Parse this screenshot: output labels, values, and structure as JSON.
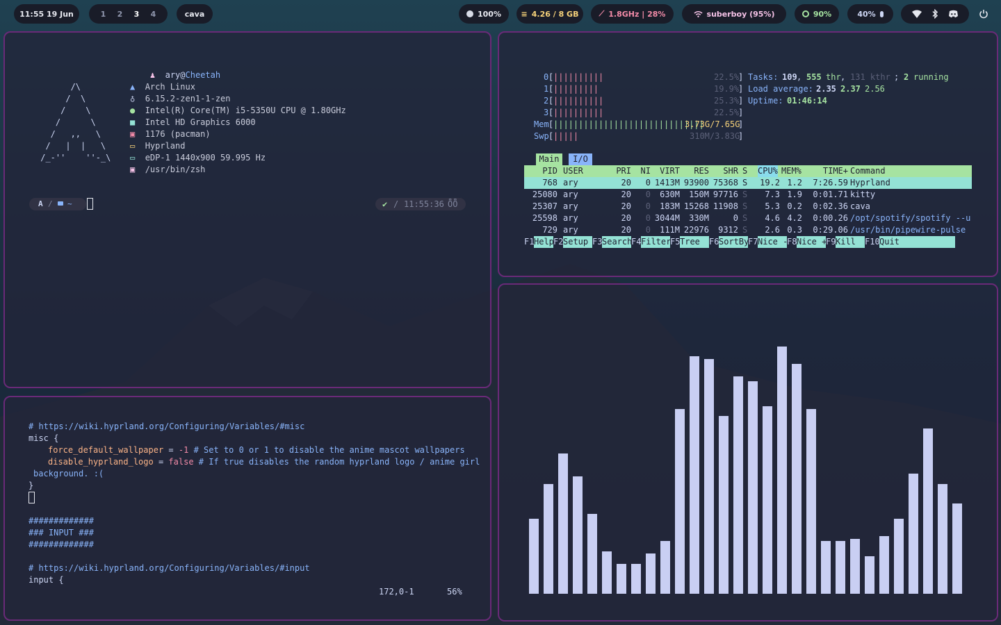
{
  "topbar": {
    "clock": "11:55  19 Jun",
    "workspaces": [
      "1",
      "2",
      "3",
      "4"
    ],
    "active_workspace": "3",
    "active_window": "cava",
    "battery": "100%",
    "memory": "4.26 / 8 GB",
    "cpu": "1.8GHz | 28%",
    "wifi": "suberboy (95%)",
    "brightness": "90%",
    "volume": "40%",
    "colors": {
      "memory": "#f6d27a",
      "cpu": "#f38ba8",
      "wifi": "#f5c2e7",
      "brightness": "#a6e3a1",
      "volume": "#cdd6f4"
    }
  },
  "fastfetch": {
    "user": "ary",
    "at": "@",
    "host": "Cheetah",
    "logo": [
      "       /\\",
      "      /  \\",
      "     /    \\",
      "    /      \\",
      "   /   ,,   \\",
      "  /   |  |   \\",
      " /_-''    ''-_\\"
    ],
    "os": "Arch Linux",
    "kernel": "6.15.2-zen1-1-zen",
    "cpu": "Intel(R) Core(TM) i5-5350U CPU @ 1.80GHz",
    "gpu": "Intel HD Graphics 6000",
    "packages": "1176 (pacman)",
    "wm": "Hyprland",
    "display": "eDP-1 1440x900 59.995 Hz",
    "shell": "/usr/bin/zsh",
    "prompt_tilde": "~",
    "prompt_time": "11:55:36"
  },
  "htop": {
    "cpus": [
      {
        "id": "0",
        "bars": "||||||||||",
        "pct": "22.5%"
      },
      {
        "id": "1",
        "bars": "|||||||||",
        "pct": "19.9%"
      },
      {
        "id": "2",
        "bars": "||||||||||",
        "pct": "25.3%"
      },
      {
        "id": "3",
        "bars": "||||||||||",
        "pct": "22.5%"
      }
    ],
    "mem_label": "Mem",
    "mem_bars": "||||||||||||||||||||||||||||||",
    "mem_value": "3.73G/7.65G",
    "swp_label": "Swp",
    "swp_bars": "|||||",
    "swp_value": "310M/3.83G",
    "tasks_label": "Tasks:",
    "tasks": "109",
    "thr": "555",
    "thr_label": "thr",
    "kthr": "131 kthr",
    "running": "2",
    "running_label": "running",
    "load_label": "Load average:",
    "load1": "2.35",
    "load5": "2.37",
    "load15": "2.56",
    "uptime_label": "Uptime:",
    "uptime": "01:46:14",
    "tabs": [
      "Main",
      "I/O"
    ],
    "columns": [
      "PID",
      "USER",
      "PRI",
      "NI",
      "VIRT",
      "RES",
      "SHR",
      "S",
      "CPU%",
      "MEM%",
      "TIME+",
      "Command"
    ],
    "rows": [
      {
        "pid": "768",
        "user": "ary",
        "pri": "20",
        "ni": "0",
        "virt": "1413M",
        "res": "93900",
        "shr": "75368",
        "s": "S",
        "cpu": "19.2",
        "mem": "1.2",
        "time": "7:26.59",
        "cmd": "Hyprland"
      },
      {
        "pid": "25080",
        "user": "ary",
        "pri": "20",
        "ni": "0",
        "virt": "630M",
        "res": "150M",
        "shr": "97716",
        "s": "S",
        "cpu": "7.3",
        "mem": "1.9",
        "time": "0:01.71",
        "cmd": "kitty"
      },
      {
        "pid": "25307",
        "user": "ary",
        "pri": "20",
        "ni": "0",
        "virt": "183M",
        "res": "15268",
        "shr": "11908",
        "s": "S",
        "cpu": "5.3",
        "mem": "0.2",
        "time": "0:02.36",
        "cmd": "cava"
      },
      {
        "pid": "25598",
        "user": "ary",
        "pri": "20",
        "ni": "0",
        "virt": "3044M",
        "res": "330M",
        "shr": "0",
        "s": "S",
        "cpu": "4.6",
        "mem": "4.2",
        "time": "0:00.26",
        "cmd": "/opt/spotify/spotify --ur"
      },
      {
        "pid": "729",
        "user": "ary",
        "pri": "20",
        "ni": "0",
        "virt": "111M",
        "res": "22976",
        "shr": "9312",
        "s": "S",
        "cpu": "2.6",
        "mem": "0.3",
        "time": "0:29.06",
        "cmd": "/usr/bin/pipewire-pulse"
      }
    ],
    "fkeys": [
      {
        "key": "F1",
        "label": "Help"
      },
      {
        "key": "F2",
        "label": "Setup"
      },
      {
        "key": "F3",
        "label": "Search"
      },
      {
        "key": "F4",
        "label": "Filter"
      },
      {
        "key": "F5",
        "label": "Tree"
      },
      {
        "key": "F6",
        "label": "SortBy"
      },
      {
        "key": "F7",
        "label": "Nice -"
      },
      {
        "key": "F8",
        "label": "Nice +"
      },
      {
        "key": "F9",
        "label": "Kill"
      },
      {
        "key": "F10",
        "label": "Quit"
      }
    ]
  },
  "editor": {
    "lines": [
      "# https://wiki.hyprland.org/Configuring/Variables/#misc",
      "misc {",
      "force_default_wallpaper",
      "=",
      "-1",
      "# Set to 0 or 1 to disable the anime mascot wallpapers",
      "disable_hyprland_logo",
      "false",
      "# If true disables the random hyprland logo / anime girl",
      "background. :(",
      "}",
      "#############",
      "### INPUT ###",
      "#############",
      "# https://wiki.hyprland.org/Configuring/Variables/#input",
      "input {"
    ],
    "position": "172,0-1",
    "percent": "56%"
  },
  "cava": {
    "bar_color": "#c9cff3",
    "levels": [
      0.3,
      0.44,
      0.56,
      0.47,
      0.32,
      0.17,
      0.12,
      0.12,
      0.16,
      0.21,
      0.74,
      0.95,
      0.94,
      0.71,
      0.87,
      0.85,
      0.75,
      0.99,
      0.92,
      0.74,
      0.21,
      0.21,
      0.22,
      0.15,
      0.23,
      0.3,
      0.48,
      0.66,
      0.44,
      0.36
    ]
  }
}
